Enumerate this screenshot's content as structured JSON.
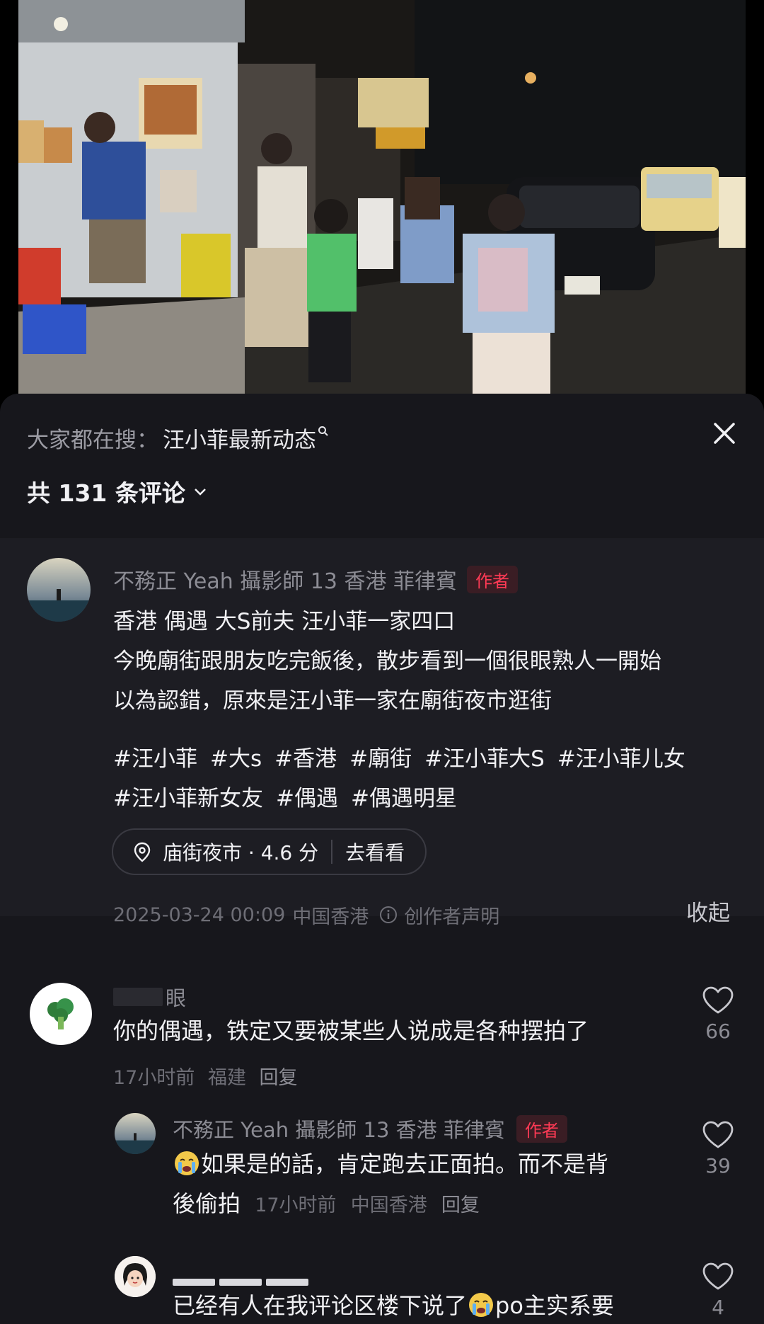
{
  "search_bar": {
    "prefix": "大家都在搜：",
    "query": "汪小菲最新动态",
    "search_icon": "search-icon",
    "close_icon": "close-icon"
  },
  "comment_count": {
    "label": "共 131 条评论",
    "chevron_icon": "chevron-down-icon"
  },
  "post": {
    "author": "不務正 Yeah 攝影師 13 香港 菲律賓",
    "author_badge": "作者",
    "lines": [
      "香港 偶遇 大S前夫 汪小菲一家四口",
      "今晚廟街跟朋友吃完飯後，散步看到一個很眼熟人一開始",
      "以為認錯，原來是汪小菲一家在廟街夜市逛街"
    ],
    "tags": [
      "#汪小菲",
      "#大s",
      "#香港",
      "#廟街",
      "#汪小菲大S",
      "#汪小菲儿女",
      "#汪小菲新女友",
      "#偶遇",
      "#偶遇明星"
    ],
    "location": {
      "name": "庙街夜市 · 4.6 分",
      "action": "去看看"
    },
    "date": "2025-03-24 00:09",
    "region": "中国香港",
    "statement": "创作者声明",
    "collapse_label": "收起"
  },
  "comments": [
    {
      "username": "眼",
      "text": "你的偶遇，铁定又要被某些人说成是各种摆拍了",
      "time": "17小时前",
      "region": "福建",
      "reply_label": "回复",
      "likes": "66"
    },
    {
      "username": "不務正 Yeah 攝影師 13 香港 菲律賓",
      "badge": "作者",
      "line1": "如果是的話，肯定跑去正面拍。而不是背",
      "line2": "後偷拍",
      "time": "17小时前",
      "region": "中国香港",
      "reply_label": "回复",
      "likes": "39"
    },
    {
      "username": "",
      "text_before": "已经有人在我评论区楼下说了",
      "text_after": "po主实系要",
      "likes": "4"
    }
  ],
  "colors": {
    "sheet_bg": "#17171c",
    "post_bg": "#1d1d23",
    "badge_red": "#ff3a55",
    "text_primary": "#f1f1f4",
    "text_secondary": "#8c8c94"
  }
}
